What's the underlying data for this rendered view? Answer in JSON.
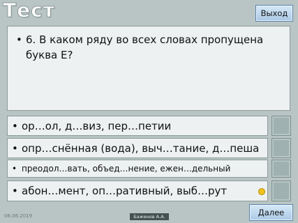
{
  "header": {
    "title": "Тест",
    "exit_label": "Выход"
  },
  "question": {
    "text": "6. В каком ряду во всех словах пропущена буква Е?"
  },
  "answers": [
    {
      "text": "ор…ол, д…виз, пер…петии"
    },
    {
      "text": "опр…снённая (вода), выч…тание, д…пеша"
    },
    {
      "text": "преодол…вать, объед…нение, ежен…дельный"
    },
    {
      "text": "абон…мент, оп…ративный, выб…рут"
    }
  ],
  "selected_marker_color": "#f0c21c",
  "footer": {
    "date": "06.06.2019",
    "author": "Баженов А.А.",
    "next_label": "Далее"
  }
}
